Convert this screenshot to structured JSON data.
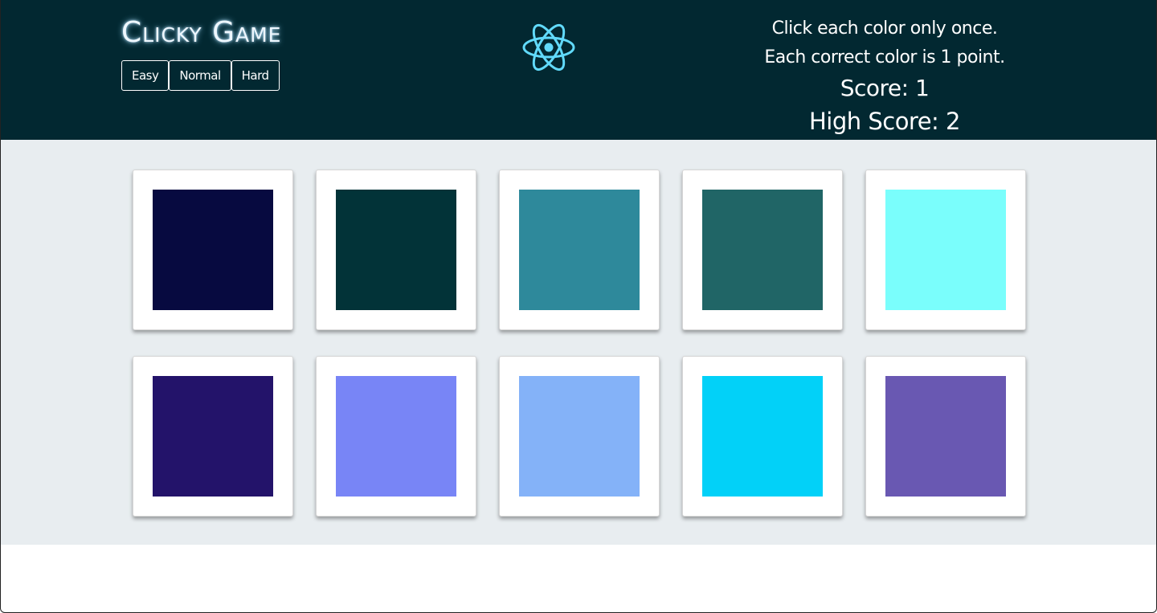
{
  "header": {
    "title": "Clicky Game",
    "difficulty": [
      "Easy",
      "Normal",
      "Hard"
    ],
    "logo_icon": "react-atom-icon",
    "logo_color": "#61dafb",
    "instructions": [
      "Click each color only once.",
      "Each correct color is 1 point."
    ],
    "score": "Score: 1",
    "high_score": "High Score: 2"
  },
  "colors": {
    "header_bg": "#022831",
    "board_bg": "#e8edf0"
  },
  "cards": [
    {
      "color": "#070a40"
    },
    {
      "color": "#023338"
    },
    {
      "color": "#2e899b"
    },
    {
      "color": "#206566"
    },
    {
      "color": "#7afefc"
    },
    {
      "color": "#23136a"
    },
    {
      "color": "#7885f6"
    },
    {
      "color": "#84b2f8"
    },
    {
      "color": "#02d1f8"
    },
    {
      "color": "#6958b2"
    }
  ]
}
